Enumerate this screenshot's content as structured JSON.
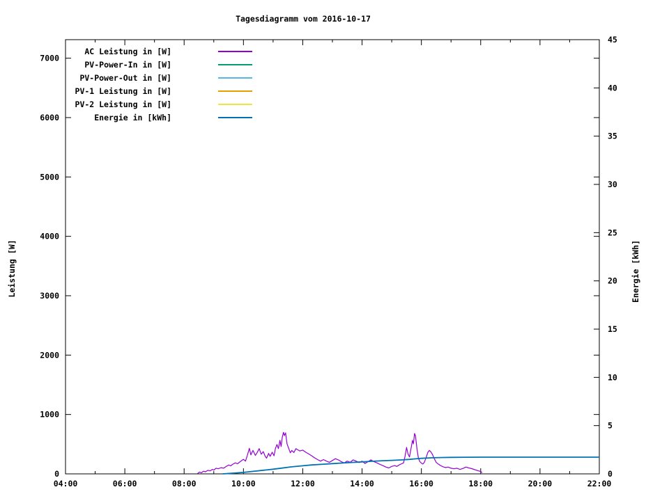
{
  "title": "Tagesdiagramm vom 2016-10-17",
  "chart_data": {
    "type": "line",
    "title": "Tagesdiagramm vom 2016-10-17",
    "x_axis": {
      "label": "",
      "unit": "time",
      "range_hours": [
        4,
        22
      ],
      "major_ticks": [
        [
          4,
          "04:00"
        ],
        [
          6,
          "06:00"
        ],
        [
          8,
          "08:00"
        ],
        [
          10,
          "10:00"
        ],
        [
          12,
          "12:00"
        ],
        [
          14,
          "14:00"
        ],
        [
          16,
          "16:00"
        ],
        [
          18,
          "18:00"
        ],
        [
          20,
          "20:00"
        ],
        [
          22,
          "22:00"
        ]
      ],
      "minor_tick_hours": [
        5,
        7,
        9,
        11,
        13,
        15,
        17,
        19,
        21
      ]
    },
    "y1_axis": {
      "label": "Leistung [W]",
      "range": [
        0,
        7312
      ],
      "ticks": [
        [
          0,
          "0"
        ],
        [
          1000,
          "1000"
        ],
        [
          2000,
          "2000"
        ],
        [
          3000,
          "3000"
        ],
        [
          4000,
          "4000"
        ],
        [
          5000,
          "5000"
        ],
        [
          6000,
          "6000"
        ],
        [
          7000,
          "7000"
        ]
      ]
    },
    "y2_axis": {
      "label": "Energie [kWh]",
      "range": [
        0,
        45
      ],
      "ticks": [
        [
          0,
          "0"
        ],
        [
          5,
          "5"
        ],
        [
          10,
          "10"
        ],
        [
          15,
          "15"
        ],
        [
          20,
          "20"
        ],
        [
          25,
          "25"
        ],
        [
          30,
          "30"
        ],
        [
          35,
          "35"
        ],
        [
          40,
          "40"
        ],
        [
          45,
          "45"
        ]
      ]
    },
    "legend_position": "top-left-inside",
    "grid": false,
    "legend": [
      {
        "id": "ac-leistung",
        "label": "AC Leistung in [W]",
        "color": "#9400d3"
      },
      {
        "id": "pv-power-in",
        "label": "PV-Power-In in [W]",
        "color": "#009e73"
      },
      {
        "id": "pv-power-out",
        "label": "PV-Power-Out in [W]",
        "color": "#56b4e9"
      },
      {
        "id": "pv1-leistung",
        "label": "PV-1 Leistung in [W]",
        "color": "#e69f00"
      },
      {
        "id": "pv2-leistung",
        "label": "PV-2 Leistung in [W]",
        "color": "#f0e442"
      },
      {
        "id": "energie",
        "label": "Energie in [kWh]",
        "color": "#0072b2"
      }
    ],
    "series": [
      {
        "id": "ac-leistung",
        "name": "AC Leistung in [W]",
        "axis": "y1",
        "color": "#9400d3",
        "width": 1.2,
        "points": [
          [
            8.45,
            5
          ],
          [
            8.52,
            30
          ],
          [
            8.58,
            18
          ],
          [
            8.65,
            45
          ],
          [
            8.72,
            35
          ],
          [
            8.8,
            60
          ],
          [
            8.88,
            50
          ],
          [
            8.95,
            75
          ],
          [
            9.0,
            65
          ],
          [
            9.08,
            95
          ],
          [
            9.15,
            85
          ],
          [
            9.25,
            105
          ],
          [
            9.33,
            95
          ],
          [
            9.42,
            125
          ],
          [
            9.5,
            150
          ],
          [
            9.57,
            135
          ],
          [
            9.65,
            165
          ],
          [
            9.73,
            185
          ],
          [
            9.8,
            170
          ],
          [
            9.9,
            210
          ],
          [
            10.0,
            245
          ],
          [
            10.07,
            215
          ],
          [
            10.13,
            310
          ],
          [
            10.2,
            430
          ],
          [
            10.25,
            320
          ],
          [
            10.32,
            395
          ],
          [
            10.4,
            310
          ],
          [
            10.47,
            365
          ],
          [
            10.53,
            425
          ],
          [
            10.6,
            330
          ],
          [
            10.67,
            375
          ],
          [
            10.73,
            300
          ],
          [
            10.78,
            265
          ],
          [
            10.85,
            345
          ],
          [
            10.9,
            295
          ],
          [
            10.97,
            365
          ],
          [
            11.03,
            305
          ],
          [
            11.08,
            430
          ],
          [
            11.13,
            495
          ],
          [
            11.18,
            425
          ],
          [
            11.23,
            565
          ],
          [
            11.27,
            460
          ],
          [
            11.31,
            620
          ],
          [
            11.35,
            700
          ],
          [
            11.38,
            645
          ],
          [
            11.42,
            690
          ],
          [
            11.47,
            505
          ],
          [
            11.53,
            425
          ],
          [
            11.58,
            355
          ],
          [
            11.63,
            395
          ],
          [
            11.7,
            360
          ],
          [
            11.77,
            425
          ],
          [
            11.83,
            405
          ],
          [
            11.9,
            385
          ],
          [
            12.0,
            400
          ],
          [
            12.1,
            365
          ],
          [
            12.2,
            335
          ],
          [
            12.3,
            305
          ],
          [
            12.4,
            270
          ],
          [
            12.5,
            240
          ],
          [
            12.6,
            215
          ],
          [
            12.7,
            240
          ],
          [
            12.8,
            215
          ],
          [
            12.9,
            195
          ],
          [
            13.0,
            225
          ],
          [
            13.1,
            255
          ],
          [
            13.2,
            235
          ],
          [
            13.3,
            205
          ],
          [
            13.4,
            185
          ],
          [
            13.5,
            215
          ],
          [
            13.6,
            195
          ],
          [
            13.7,
            235
          ],
          [
            13.8,
            215
          ],
          [
            13.9,
            190
          ],
          [
            14.0,
            215
          ],
          [
            14.1,
            175
          ],
          [
            14.2,
            205
          ],
          [
            14.3,
            235
          ],
          [
            14.4,
            205
          ],
          [
            14.5,
            185
          ],
          [
            14.6,
            160
          ],
          [
            14.7,
            140
          ],
          [
            14.8,
            115
          ],
          [
            14.9,
            100
          ],
          [
            15.0,
            125
          ],
          [
            15.1,
            140
          ],
          [
            15.17,
            125
          ],
          [
            15.25,
            150
          ],
          [
            15.33,
            170
          ],
          [
            15.4,
            185
          ],
          [
            15.45,
            300
          ],
          [
            15.5,
            445
          ],
          [
            15.55,
            335
          ],
          [
            15.6,
            285
          ],
          [
            15.65,
            425
          ],
          [
            15.7,
            565
          ],
          [
            15.73,
            505
          ],
          [
            15.77,
            680
          ],
          [
            15.8,
            640
          ],
          [
            15.85,
            425
          ],
          [
            15.9,
            265
          ],
          [
            15.95,
            205
          ],
          [
            16.0,
            180
          ],
          [
            16.05,
            165
          ],
          [
            16.1,
            195
          ],
          [
            16.17,
            290
          ],
          [
            16.22,
            365
          ],
          [
            16.27,
            395
          ],
          [
            16.32,
            370
          ],
          [
            16.37,
            330
          ],
          [
            16.43,
            260
          ],
          [
            16.5,
            195
          ],
          [
            16.57,
            165
          ],
          [
            16.65,
            140
          ],
          [
            16.73,
            120
          ],
          [
            16.82,
            105
          ],
          [
            16.9,
            115
          ],
          [
            17.0,
            95
          ],
          [
            17.1,
            85
          ],
          [
            17.2,
            95
          ],
          [
            17.3,
            75
          ],
          [
            17.4,
            90
          ],
          [
            17.5,
            115
          ],
          [
            17.6,
            100
          ],
          [
            17.7,
            88
          ],
          [
            17.8,
            70
          ],
          [
            17.9,
            55
          ],
          [
            18.0,
            40
          ],
          [
            18.05,
            20
          ]
        ]
      },
      {
        "id": "pv-power-in",
        "name": "PV-Power-In in [W]",
        "axis": "y1",
        "color": "#009e73",
        "width": 1.2,
        "points": []
      },
      {
        "id": "pv-power-out",
        "name": "PV-Power-Out in [W]",
        "axis": "y1",
        "color": "#56b4e9",
        "width": 1.2,
        "points": []
      },
      {
        "id": "pv1-leistung",
        "name": "PV-1 Leistung in [W]",
        "axis": "y1",
        "color": "#e69f00",
        "width": 1.2,
        "points": []
      },
      {
        "id": "pv2-leistung",
        "name": "PV-2 Leistung in [W]",
        "axis": "y1",
        "color": "#f0e442",
        "width": 1.2,
        "points": []
      },
      {
        "id": "energie",
        "name": "Energie in [kWh]",
        "axis": "y2",
        "color": "#0072b2",
        "width": 1.8,
        "points": [
          [
            9.3,
            0
          ],
          [
            9.6,
            0.06
          ],
          [
            10.0,
            0.15
          ],
          [
            10.3,
            0.25
          ],
          [
            10.7,
            0.38
          ],
          [
            11.0,
            0.48
          ],
          [
            11.3,
            0.6
          ],
          [
            11.6,
            0.72
          ],
          [
            12.0,
            0.84
          ],
          [
            12.3,
            0.92
          ],
          [
            12.7,
            1.0
          ],
          [
            13.0,
            1.06
          ],
          [
            13.3,
            1.12
          ],
          [
            13.7,
            1.19
          ],
          [
            14.0,
            1.24
          ],
          [
            14.3,
            1.3
          ],
          [
            14.7,
            1.36
          ],
          [
            15.0,
            1.4
          ],
          [
            15.3,
            1.44
          ],
          [
            15.6,
            1.5
          ],
          [
            15.8,
            1.56
          ],
          [
            16.0,
            1.61
          ],
          [
            16.3,
            1.66
          ],
          [
            16.6,
            1.69
          ],
          [
            17.0,
            1.71
          ],
          [
            17.5,
            1.72
          ],
          [
            18.0,
            1.73
          ],
          [
            20.0,
            1.73
          ],
          [
            22.0,
            1.73
          ]
        ]
      }
    ]
  },
  "colors": {
    "background": "#ffffff",
    "border": "#000000",
    "text": "#000000"
  }
}
